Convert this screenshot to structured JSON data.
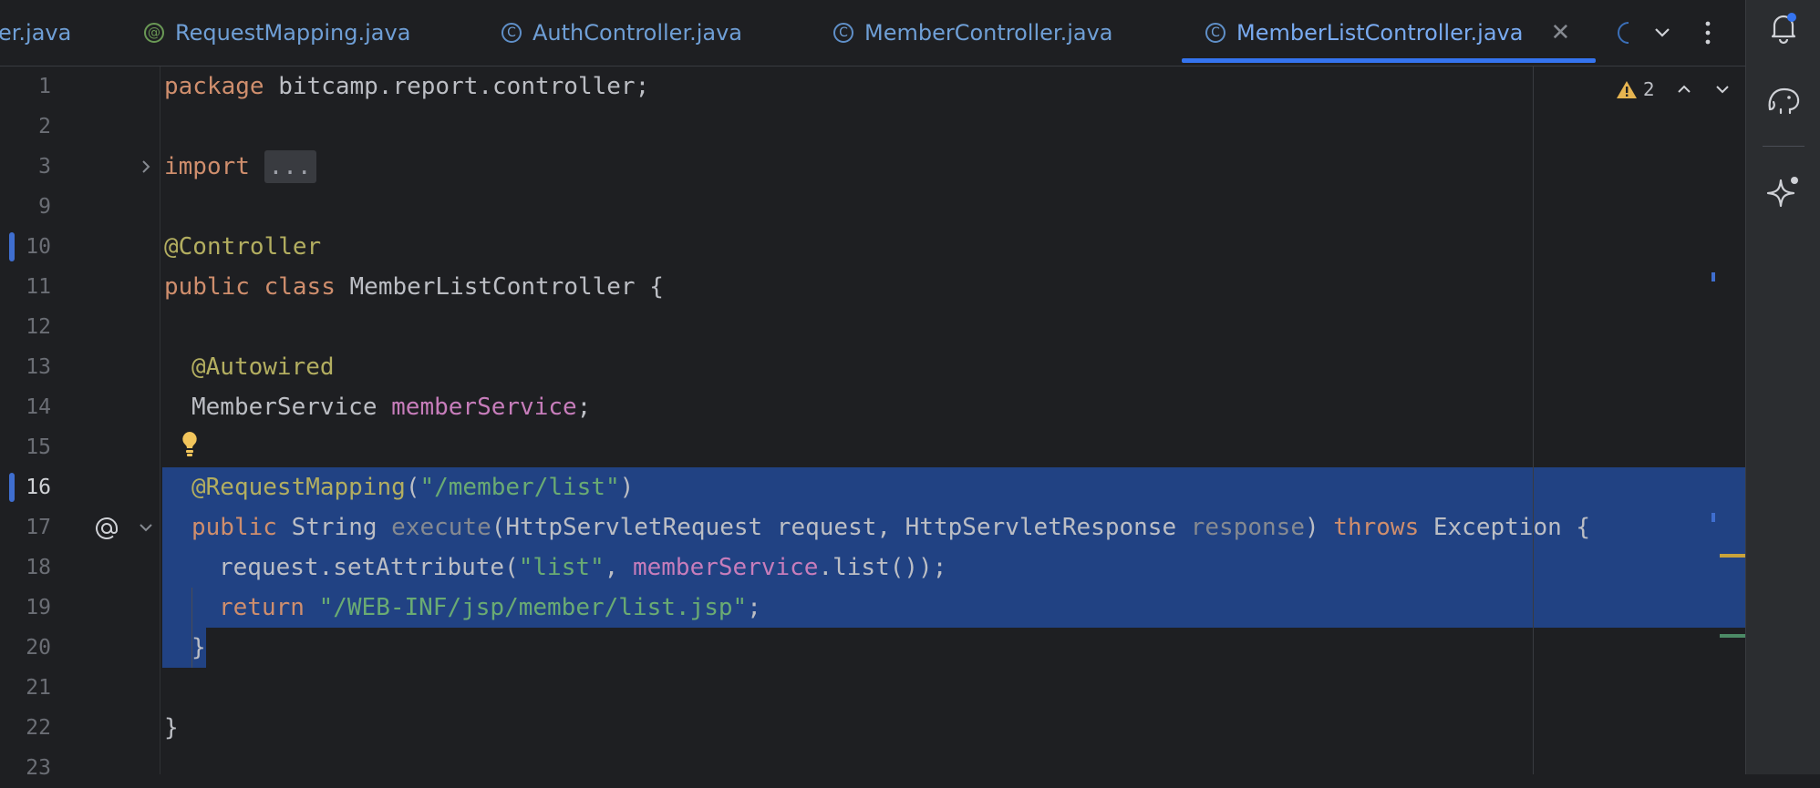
{
  "tabs": [
    {
      "label": "er.java",
      "icon": "class-icon",
      "active": false
    },
    {
      "label": "RequestMapping.java",
      "icon": "annotation-icon",
      "active": false
    },
    {
      "label": "AuthController.java",
      "icon": "class-icon",
      "active": false
    },
    {
      "label": "MemberController.java",
      "icon": "class-icon",
      "active": false
    },
    {
      "label": "MemberListController.java",
      "icon": "class-icon",
      "active": true
    }
  ],
  "tab_icon_glyphs": {
    "class": "C",
    "annotation": "@"
  },
  "tab_close_glyph": "✕",
  "inspections": {
    "warning_count": "2"
  },
  "gutter": {
    "line_numbers": [
      "1",
      "2",
      "3",
      "9",
      "10",
      "11",
      "12",
      "13",
      "14",
      "15",
      "16",
      "17",
      "18",
      "19",
      "20",
      "21",
      "22",
      "23"
    ],
    "current_line": "16"
  },
  "code": {
    "l1_kw": "package",
    "l1_rest": " bitcamp.report.controller;",
    "l3_kw": "import",
    "l3_fold": "...",
    "l10_ann": "@Controller",
    "l11_kw1": "public",
    "l11_kw2": "class",
    "l11_rest": " MemberListController {",
    "l13_ann": "@Autowired",
    "l14_type": "MemberService ",
    "l14_field": "memberService",
    "l14_end": ";",
    "l16_ann": "@RequestMapping",
    "l16_open": "(",
    "l16_str": "\"/member/list\"",
    "l16_close": ")",
    "l17_kw": "public",
    "l17_type": " String ",
    "l17_method": "execute",
    "l17_params": "(HttpServletRequest request, HttpServletResponse ",
    "l17_unused": "response",
    "l17_close": ") ",
    "l17_throws": "throws",
    "l17_end": " Exception {",
    "l18_start": "request.setAttribute(",
    "l18_str": "\"list\"",
    "l18_mid": ", ",
    "l18_field": "memberService",
    "l18_end": ".list());",
    "l19_kw": "return",
    "l19_sp": " ",
    "l19_str": "\"/WEB-INF/jsp/member/list.jsp\"",
    "l19_end": ";",
    "l20": "}",
    "l22": "}"
  },
  "colors": {
    "background": "#1e1f22",
    "selection": "#214283",
    "keyword": "#cf8e6d",
    "annotation": "#b3ae60",
    "string": "#6aab73",
    "field": "#c77dbb",
    "accent": "#3574f0"
  }
}
